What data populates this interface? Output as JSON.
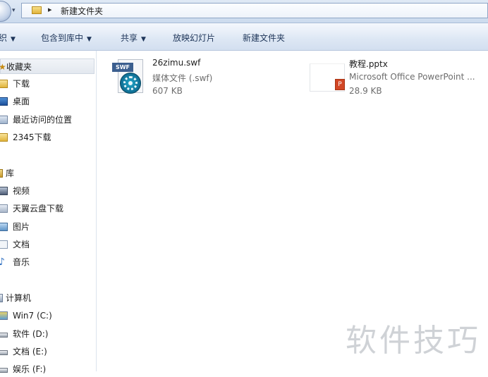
{
  "address_bar": {
    "separator": "▸",
    "breadcrumb": "新建文件夹",
    "history_arrow": "▾"
  },
  "toolbar": {
    "organize": "织",
    "include_in_library": "包含到库中",
    "share": "共享",
    "slideshow": "放映幻灯片",
    "new_folder": "新建文件夹",
    "dropdown_glyph": "▼"
  },
  "nav": {
    "favorites": "收藏夹",
    "downloads": "下载",
    "desktop": "桌面",
    "recent": "最近访问的位置",
    "downloads_2345": "2345下载",
    "libraries": "库",
    "videos": "视频",
    "tianyi": "天翼云盘下载",
    "pictures": "图片",
    "documents": "文档",
    "music": "音乐",
    "computer": "计算机",
    "drive_c": "Win7 (C:)",
    "drive_d": "软件 (D:)",
    "drive_e": "文档 (E:)",
    "drive_f": "娱乐 (F:)"
  },
  "files": [
    {
      "name": "26zimu.swf",
      "type": "媒体文件 (.swf)",
      "size": "607 KB",
      "icon": "swf-media-icon",
      "icon_tag": "SWF"
    },
    {
      "name": "教程.pptx",
      "type": "Microsoft Office PowerPoint ...",
      "size": "28.9 KB",
      "icon": "powerpoint-file-icon"
    }
  ],
  "watermark": "软件技巧",
  "colors": {
    "toolbar_text": "#1e3559",
    "secondary_text": "#6d6d6d",
    "watermark": "#cfd2d6"
  }
}
